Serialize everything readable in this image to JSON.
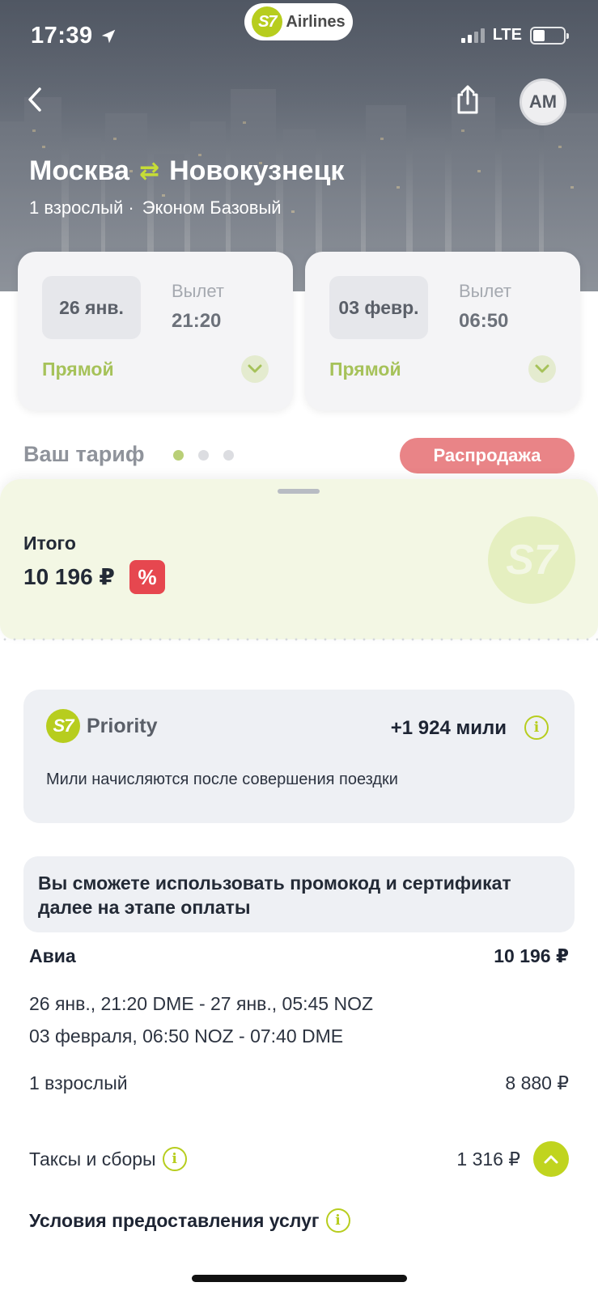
{
  "status_bar": {
    "time": "17:39",
    "network": "LTE"
  },
  "brand": {
    "logo_text": "S7",
    "name": "Airlines"
  },
  "header": {
    "avatar_initials": "AM",
    "origin": "Москва",
    "destination": "Новокузнецк",
    "passengers": "1 взрослый ·",
    "fare_class": "Эконом Базовый"
  },
  "flights": [
    {
      "date": "26 янв.",
      "label": "Вылет",
      "time": "21:20",
      "type": "Прямой"
    },
    {
      "date": "03 февр.",
      "label": "Вылет",
      "time": "06:50",
      "type": "Прямой"
    }
  ],
  "tariff": {
    "title": "Ваш тариф",
    "badge": "Распродажа",
    "page_index": 0,
    "page_count": 3
  },
  "total": {
    "label": "Итого",
    "amount": "10 196 ₽",
    "discount_icon": "%",
    "watermark": "S7"
  },
  "priority": {
    "logo_text": "S7",
    "name": "Priority",
    "miles": "+1 924 мили",
    "note": "Мили начисляются после совершения поездки"
  },
  "promo": {
    "text": "Вы сможете использовать промокод и сертификат далее на этапе оплаты"
  },
  "breakdown": {
    "avia_title": "Авиа",
    "avia_sum": "10 196 ₽",
    "segments": [
      "26 янв., 21:20 DME - 27 янв., 05:45 NOZ",
      "03 февраля, 06:50 NOZ - 07:40 DME"
    ],
    "adult_label": "1 взрослый",
    "adult_sum": "8 880 ₽",
    "taxes_label": "Таксы и сборы",
    "taxes_sum": "1 316 ₽",
    "terms_label": "Условия предоставления услуг"
  },
  "colors": {
    "accent": "#b7cd1e",
    "sale": "#e98487",
    "discount": "#e6474f",
    "sheet": "#f3f7e4"
  }
}
